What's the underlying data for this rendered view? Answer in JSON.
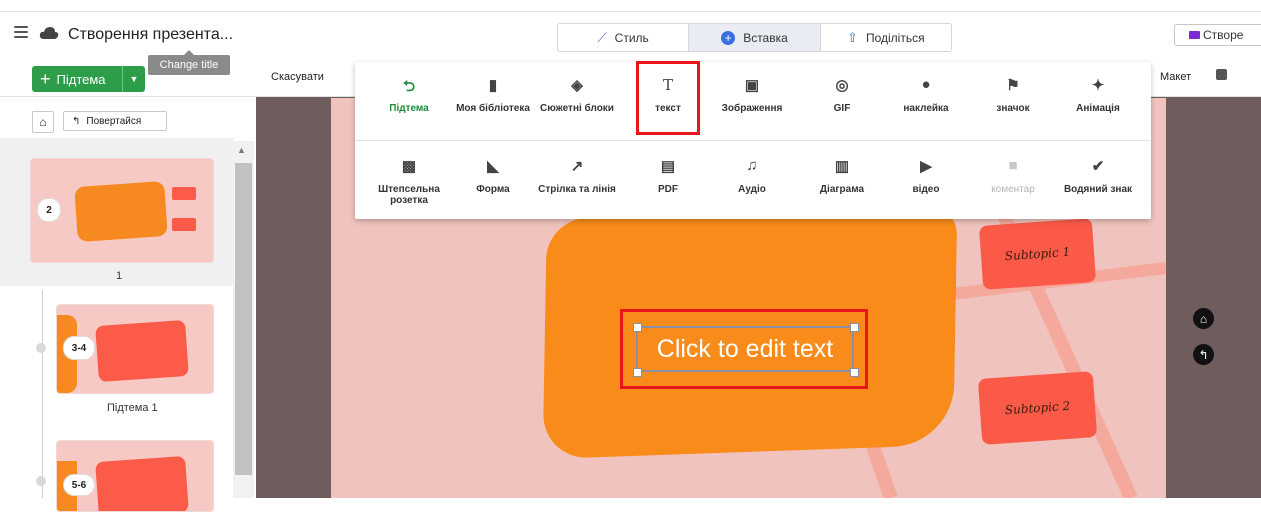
{
  "header": {
    "title": "Створення презента...",
    "tabs": [
      {
        "label": "Стиль",
        "icon": "magic-wand-icon"
      },
      {
        "label": "Вставка",
        "icon": "plus-circle-icon"
      },
      {
        "label": "Поділіться",
        "icon": "share-icon"
      }
    ],
    "create_label": "Створе",
    "tooltip": "Change title"
  },
  "toolbar": {
    "subtopic_label": "Підтема",
    "cancel_label": "Скасувати",
    "layout_label": "Макет"
  },
  "left_panel": {
    "back_label": "Повертайся",
    "slides": [
      {
        "badge": "2",
        "label": "1"
      },
      {
        "badge": "3-4",
        "label": "Підтема 1"
      },
      {
        "badge": "5-6",
        "label": ""
      }
    ]
  },
  "insert_menu": {
    "row1": [
      {
        "label": "Підтема",
        "icon": "subtopic-icon"
      },
      {
        "label": "Моя бібліотека",
        "icon": "library-icon"
      },
      {
        "label": "Сюжетні блоки",
        "icon": "layers-icon"
      },
      {
        "label": "текст",
        "icon": "text-icon"
      },
      {
        "label": "Зображення",
        "icon": "image-icon"
      },
      {
        "label": "GIF",
        "icon": "gif-icon"
      },
      {
        "label": "наклейка",
        "icon": "sticker-icon"
      },
      {
        "label": "значок",
        "icon": "flag-icon"
      },
      {
        "label": "Анімація",
        "icon": "animation-icon"
      }
    ],
    "row2": [
      {
        "label": "Штепсельна розетка",
        "icon": "plug-icon"
      },
      {
        "label": "Форма",
        "icon": "shape-icon"
      },
      {
        "label": "Стрілка та лінія",
        "icon": "arrow-icon"
      },
      {
        "label": "PDF",
        "icon": "pdf-icon"
      },
      {
        "label": "Аудіо",
        "icon": "music-icon"
      },
      {
        "label": "Діаграма",
        "icon": "chart-icon"
      },
      {
        "label": "відео",
        "icon": "video-icon"
      },
      {
        "label": "коментар",
        "icon": "comment-icon"
      },
      {
        "label": "Водяний знак",
        "icon": "watermark-icon"
      }
    ]
  },
  "slide": {
    "text": "Click to edit text",
    "subtopic1": "Subtopic 1",
    "subtopic2": "Subtopic 2"
  },
  "colors": {
    "accent": "#2e9d4a",
    "highlight": "#e8151b",
    "orange": "#f88b19",
    "red": "#fb5a48"
  }
}
